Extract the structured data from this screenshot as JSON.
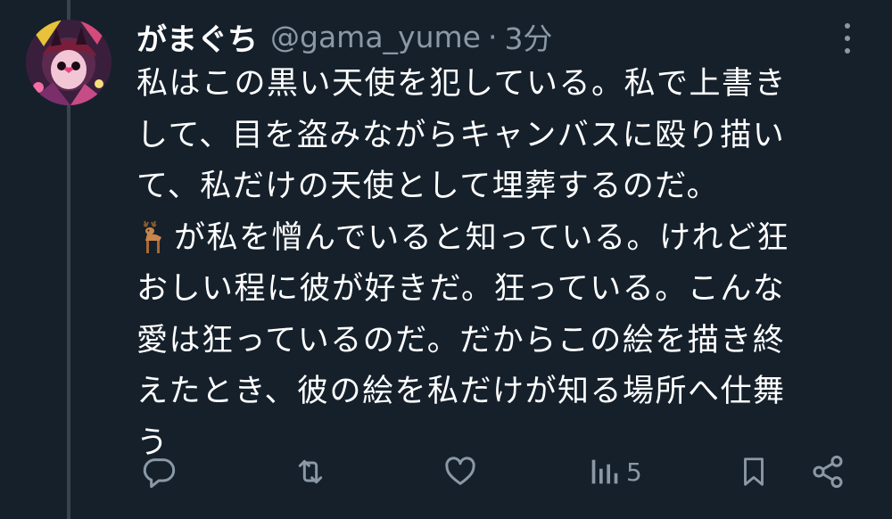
{
  "tweet": {
    "display_name": "がまぐち",
    "handle": "@gama_yume",
    "separator": "·",
    "time": "3分",
    "lines": [
      "私はこの黒い天使を犯している。私で上書き",
      "して、目を盗みながらキャンバスに殴り描い",
      "て、私だけの天使として埋葬するのだ。",
      "が私を憎んでいると知っている。けれど狂",
      "おしい程に彼が好きだ。狂っている。こんな",
      "愛は狂っているのだ。だからこの絵を描き終",
      "えたとき、彼の絵を私だけが知る場所へ仕舞",
      "う"
    ],
    "emoji": "🦌"
  },
  "actions": {
    "reply_icon": "reply-icon",
    "retweet_icon": "retweet-icon",
    "like_icon": "heart-icon",
    "views_icon": "views-icon",
    "views_count": "5",
    "bookmark_icon": "bookmark-icon",
    "share_icon": "share-icon"
  },
  "colors": {
    "background": "#15202b",
    "text": "#ffffff",
    "secondary": "#8b98a5",
    "thread_line": "#38444d"
  }
}
